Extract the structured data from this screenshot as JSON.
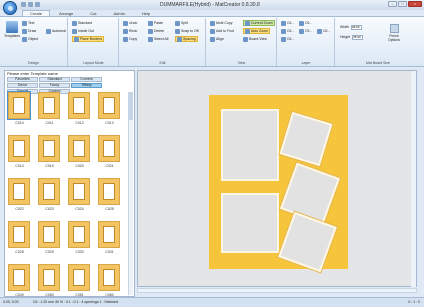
{
  "window": {
    "title": "DUMMARFILE(Hybrid) - MatCreator 0.8.30.8",
    "controls": [
      "minimize",
      "maximize",
      "close"
    ]
  },
  "tabs": [
    "Create",
    "Arrange",
    "Cut",
    "Admin",
    "Help"
  ],
  "ribbon": {
    "groups": [
      "Design",
      "Layout Mode",
      "Edit",
      "View",
      "Layer",
      "Mat Board Size"
    ],
    "design": {
      "templates": "Templates",
      "text": "Text",
      "draw": "Draw",
      "autoheal": "Autoheal",
      "object": "Object"
    },
    "layout": {
      "standard": "Standard",
      "inside_out": "Inside Out",
      "place_borders": "Place Borders"
    },
    "edit": {
      "undo": "Undo",
      "paste": "Paste",
      "split": "Split",
      "redo": "Redo",
      "delete": "Delete",
      "snap": "Snap to Off",
      "copy": "Copy",
      "select_all": "Select All",
      "spacing": "Spacing"
    },
    "view": {
      "multi_copy": "Multi Copy",
      "add_to_pool": "Add to Pool",
      "align": "Align",
      "current_zoom": "Current Zoom",
      "auto_zoom": "Auto Zoom",
      "board_view": "Board View"
    },
    "layer": [
      "C6 -",
      "C6 -",
      "C6 -",
      "C6 -",
      "C5 -",
      "C6 -"
    ],
    "size": {
      "width_label": "Width",
      "width_value": "28.00",
      "height_label": "Height",
      "height_value": "35.60",
      "options": "Finish Options"
    }
  },
  "panel": {
    "title": "Please enter Template name",
    "categories": [
      "Favorites",
      "Standard",
      "Corners",
      "Decor",
      "Fancy",
      "Tiffany",
      "Special",
      "Custom"
    ],
    "active_category": "Tiffany",
    "templates": [
      "C010",
      "C011",
      "C012",
      "C013",
      "C014",
      "C019",
      "C020",
      "C021",
      "C022",
      "C023",
      "C024",
      "C025",
      "C028",
      "C029",
      "C030",
      "C031",
      "C049",
      "C050",
      "C051",
      "C060"
    ]
  },
  "status": {
    "coords": "0.00, 0.00",
    "info": "C6 : 1.20 mm    30 %  : 0.1 : 0.1 : 4 openings  1 : Selected",
    "right": "0 : 1 : 0"
  },
  "colors": {
    "mat_board": "#f6c53c",
    "opening": "#e2e2e3",
    "highlight": "#ffe07a"
  }
}
